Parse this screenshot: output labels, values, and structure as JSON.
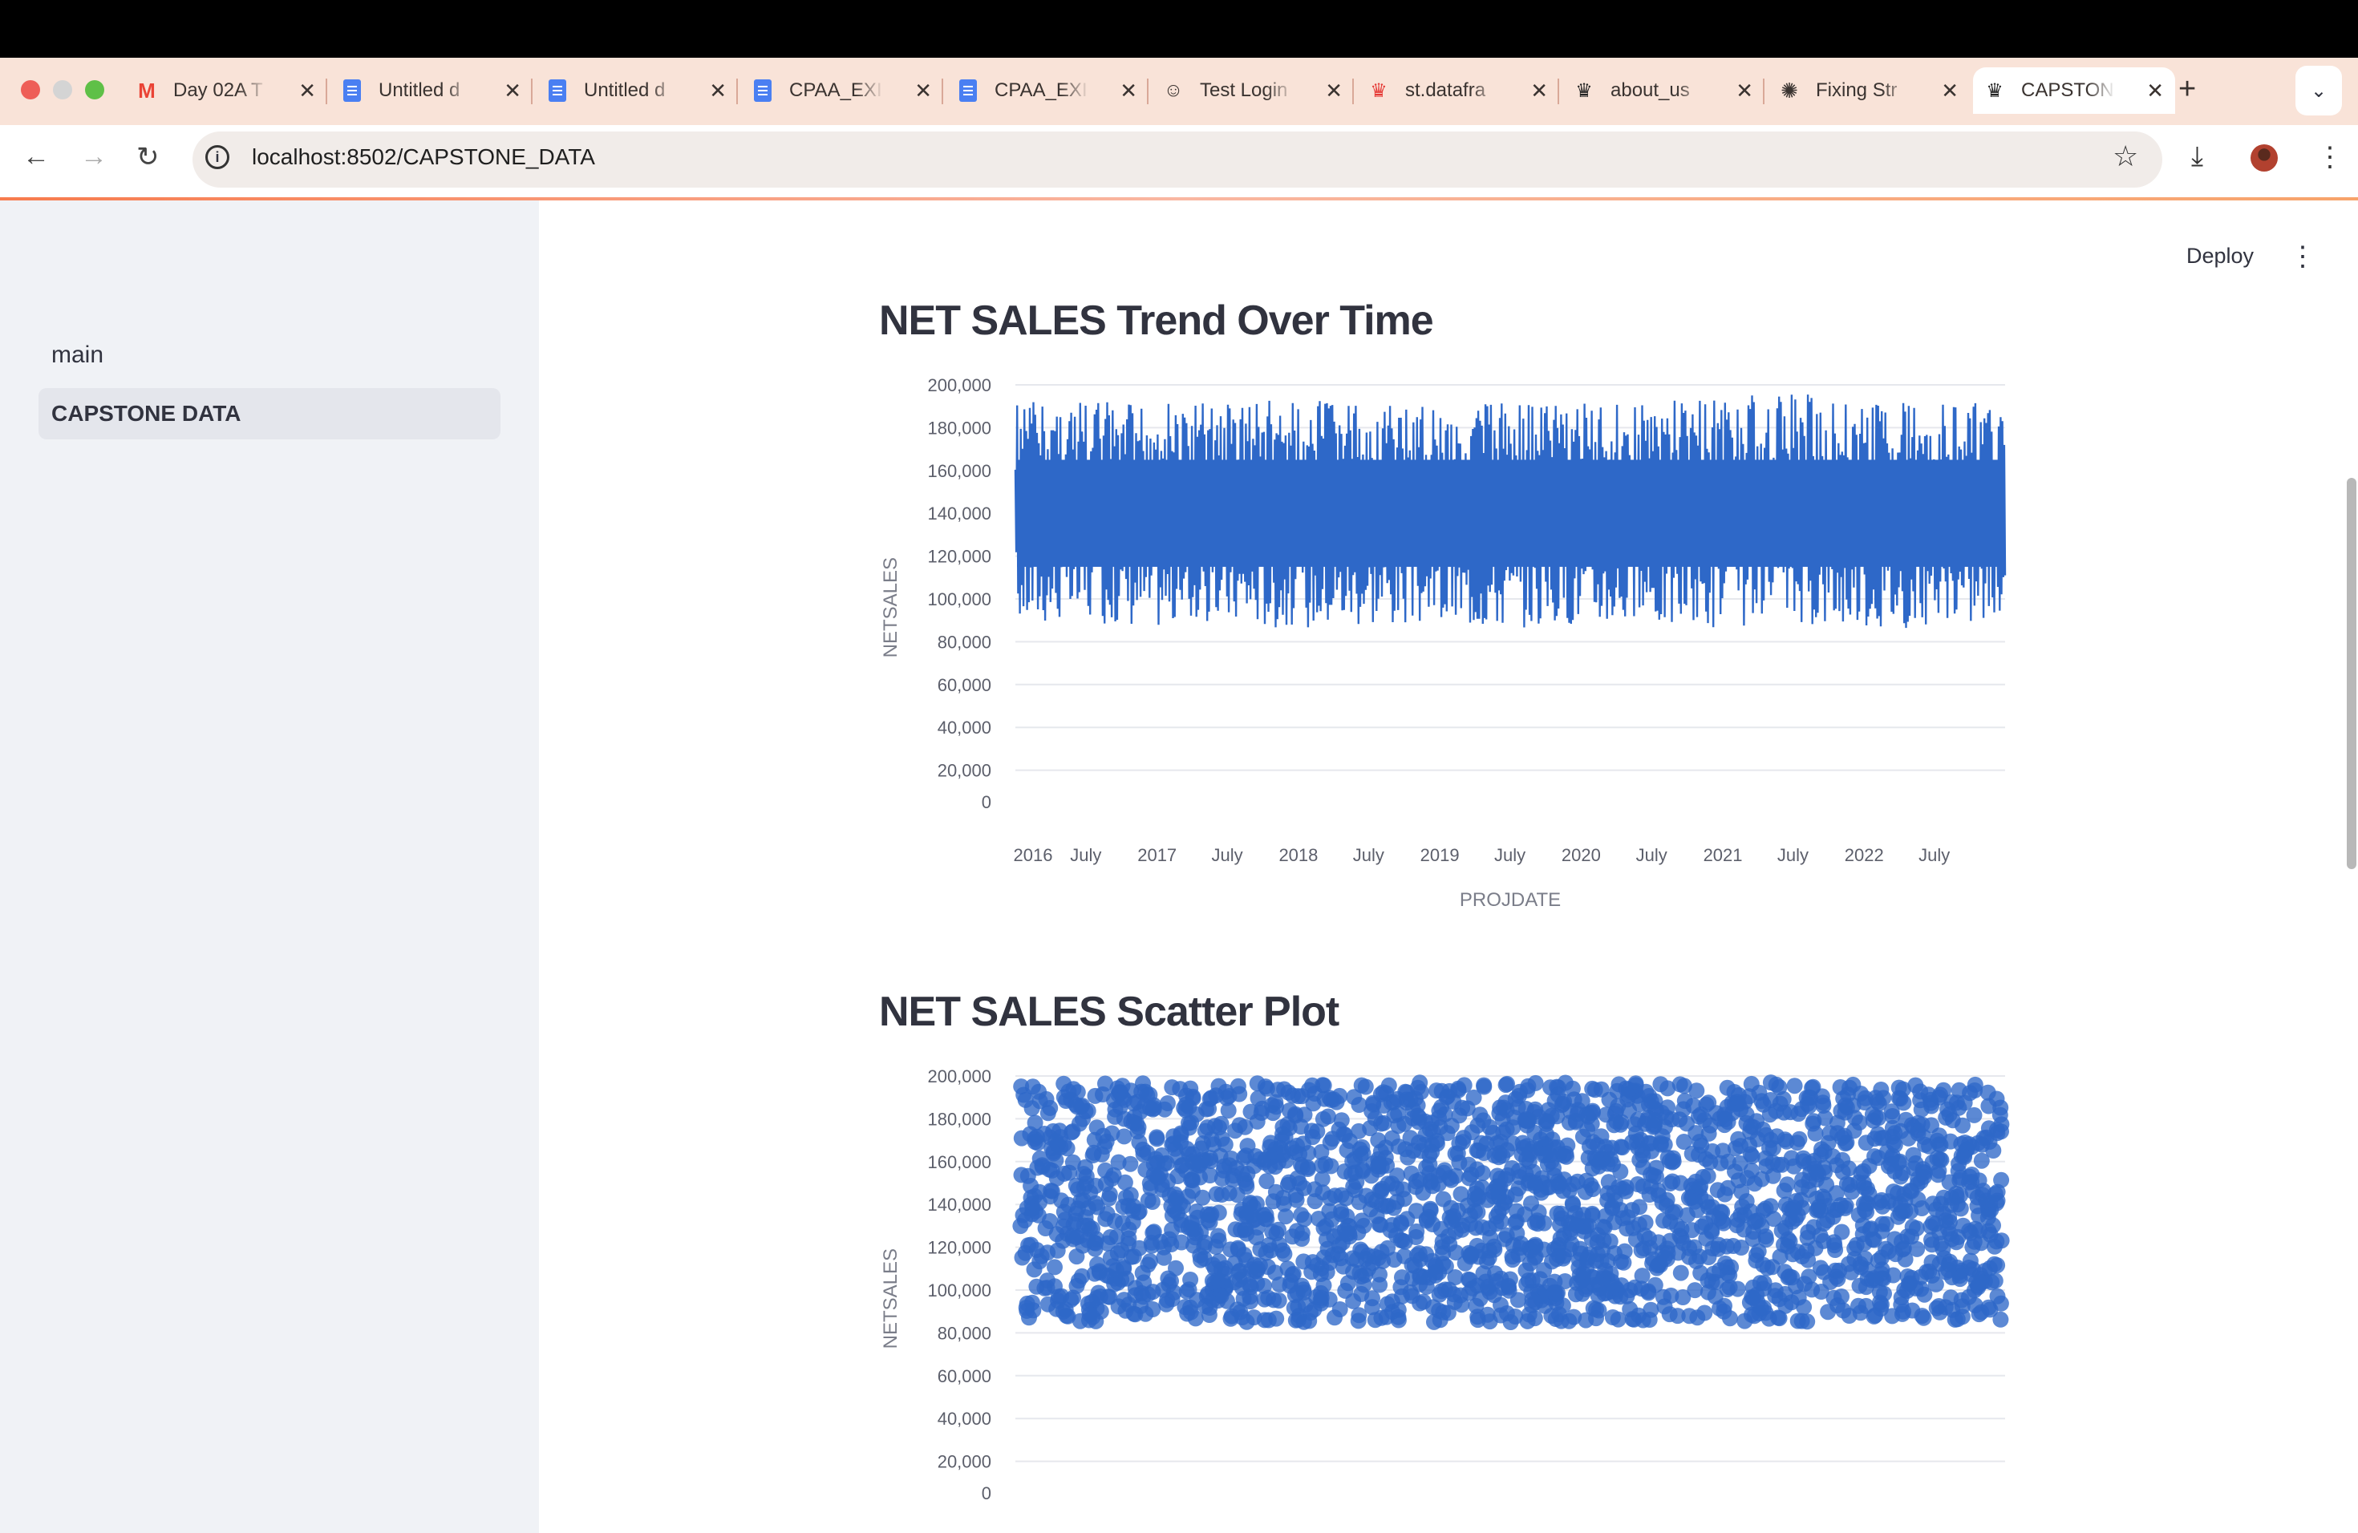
{
  "browser": {
    "tabs": [
      {
        "label": "Day 02A T",
        "icon": "gmail-icon"
      },
      {
        "label": "Untitled d",
        "icon": "docs-icon"
      },
      {
        "label": "Untitled d",
        "icon": "docs-icon"
      },
      {
        "label": "CPAA_EXI",
        "icon": "docs-icon"
      },
      {
        "label": "CPAA_EXI",
        "icon": "docs-icon"
      },
      {
        "label": "Test Login",
        "icon": "github-icon"
      },
      {
        "label": "st.datafra",
        "icon": "streamlit-icon"
      },
      {
        "label": "about_us",
        "icon": "streamlit-icon"
      },
      {
        "label": "Fixing Str",
        "icon": "openai-icon"
      },
      {
        "label": "CAPSTON",
        "icon": "streamlit-icon",
        "active": true
      }
    ],
    "url": "localhost:8502/CAPSTONE_DATA"
  },
  "sidebar": {
    "items": [
      {
        "label": "main"
      },
      {
        "label": "CAPSTONE DATA",
        "active": true
      }
    ]
  },
  "header": {
    "deploy_label": "Deploy"
  },
  "main": {
    "chart1_title": "NET SALES Trend Over Time",
    "chart2_title": "NET SALES Scatter Plot"
  },
  "chart_data": [
    {
      "type": "line",
      "title": "NET SALES Trend Over Time",
      "xlabel": "PROJDATE",
      "ylabel": "NETSALES",
      "x_tick_labels": [
        "2016",
        "July",
        "2017",
        "July",
        "2018",
        "July",
        "2019",
        "July",
        "2020",
        "July",
        "2021",
        "July",
        "2022",
        "July"
      ],
      "y_tick_labels": [
        "0",
        "20,000",
        "40,000",
        "60,000",
        "80,000",
        "100,000",
        "120,000",
        "140,000",
        "160,000",
        "180,000",
        "200,000"
      ],
      "xlim": [
        "2016-01-01",
        "2022-12-31"
      ],
      "ylim": [
        0,
        200000
      ],
      "color": "#2e68c8",
      "grid": true,
      "series": [
        {
          "values_summary": "daily values fluctuating between about 85,000 and 195,000",
          "x": [
            "2016-01-01",
            "2016-07-01",
            "2017-01-01",
            "2017-07-01",
            "2018-01-01",
            "2018-07-01",
            "2019-01-01",
            "2019-07-01",
            "2020-01-01",
            "2020-07-01",
            "2021-01-01",
            "2021-07-01",
            "2022-01-01",
            "2022-07-01",
            "2022-12-31"
          ],
          "min": [
            88000,
            89000,
            87000,
            88000,
            86000,
            88000,
            87000,
            86000,
            88000,
            87000,
            86000,
            88000,
            87000,
            86000,
            89000
          ],
          "max": [
            193000,
            193000,
            191000,
            192000,
            193000,
            192000,
            191000,
            192000,
            193000,
            192000,
            195000,
            197000,
            193000,
            192000,
            192000
          ]
        }
      ]
    },
    {
      "type": "scatter",
      "title": "NET SALES Scatter Plot",
      "ylabel": "NETSALES",
      "y_tick_labels": [
        "0",
        "20,000",
        "40,000",
        "60,000",
        "80,000",
        "100,000",
        "120,000",
        "140,000",
        "160,000",
        "180,000",
        "200,000"
      ],
      "ylim": [
        0,
        200000
      ],
      "y_range_of_points": [
        85000,
        197000
      ],
      "color": "#2e68c8",
      "grid": true
    }
  ]
}
